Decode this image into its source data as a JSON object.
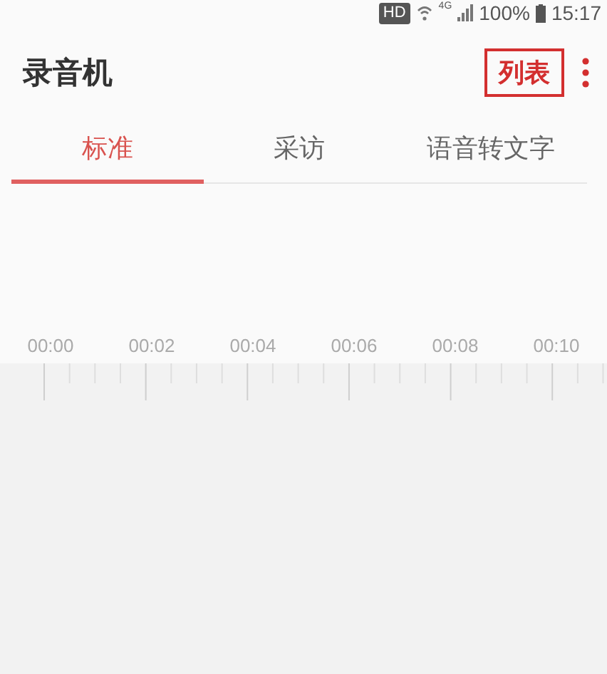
{
  "status_bar": {
    "hd": "HD",
    "network": "4G",
    "battery": "100%",
    "time": "15:17"
  },
  "app_bar": {
    "title": "录音机",
    "list_button": "列表"
  },
  "tabs": [
    {
      "label": "标准",
      "selected": true
    },
    {
      "label": "采访",
      "selected": false
    },
    {
      "label": "语音转文字",
      "selected": false
    }
  ],
  "timeline": {
    "labels": [
      "00:00",
      "00:02",
      "00:04",
      "00:06",
      "00:08",
      "00:10"
    ]
  }
}
